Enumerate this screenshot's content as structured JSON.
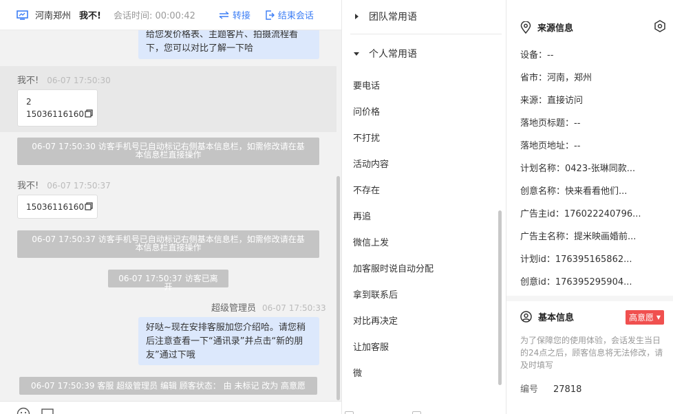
{
  "header": {
    "location": "河南郑州",
    "visitor_name": "我不!",
    "session_time_label": "会话时间:",
    "session_time": "00:00:42",
    "transfer_label": "转接",
    "end_label": "结束会话"
  },
  "messages": {
    "agent_msg_1": [
      "给您发价格表、主题客片、拍摄流程看",
      "下，您可以对比了解一下哈"
    ],
    "visitor_1": {
      "name": "我不!",
      "time": "06-07 17:50:30",
      "line1": "2",
      "line2": "15036116160"
    },
    "system_1": [
      "06-07 17:50:30 访客手机号已自动标记右侧基本信息栏，如需修改请在基",
      "本信息栏直接操作"
    ],
    "visitor_2": {
      "name": "我不!",
      "time": "06-07 17:50:37",
      "line1": "15036116160"
    },
    "system_2": [
      "06-07 17:50:37 访客手机号已自动标记右侧基本信息栏，如需修改请在基",
      "本信息栏直接操作"
    ],
    "system_3": "06-07 17:50:37 访客已离开",
    "agent_2": {
      "name": "超级管理员",
      "time": "06-07 17:50:33",
      "lines": [
        "好哒~现在安排客服加您介绍哈。请您稍",
        "后注意查看一下“通讯录”并点击“新的朋",
        "友”通过下哦"
      ]
    },
    "system_4": "06-07 17:50:39 客服 超级管理员 编辑 顾客状态： 由 未标记 改为 高意愿"
  },
  "phrases": {
    "team_group": "团队常用语",
    "personal_group": "个人常用语",
    "items": [
      "要电话",
      "问价格",
      "不打扰",
      "活动内容",
      "不存在",
      "再追",
      "微信上发",
      "加客服时说自动分配",
      "拿到联系后",
      "对比再决定",
      "让加客服",
      "微"
    ]
  },
  "source_info": {
    "title": "来源信息",
    "rows": [
      "设备：--",
      "省市：河南，郑州",
      "来源：直接访问",
      "落地页标题：--",
      "落地页地址：--",
      "计划名称：0423-张琳同款...",
      "创意名称：快来看看他们...",
      "广告主id：176022240796...",
      "广告主名称：提米映画婚前...",
      "计划id：176395165862...",
      "创意id：176395295904..."
    ]
  },
  "basic_info": {
    "title": "基本信息",
    "intent_badge": "高意愿",
    "note": "为了保障您的使用体验，会话发生当日的24点之后，顾客信息将无法修改，请及时填写",
    "id_label": "编号",
    "id_value": "27818"
  },
  "colors": {
    "accent": "#3b7df5",
    "agent_bubble": "#dce8fc",
    "system_bg": "#c4c4c4",
    "badge": "#f0504f"
  }
}
